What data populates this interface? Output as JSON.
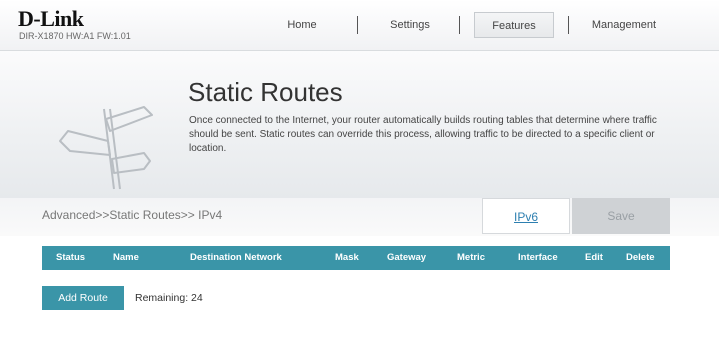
{
  "brand": {
    "logo": "D-Link",
    "model": "DIR-X1870 HW:A1 FW:1.01"
  },
  "nav": {
    "items": [
      {
        "label": "Home"
      },
      {
        "label": "Settings"
      },
      {
        "label": "Features",
        "active": true
      },
      {
        "label": "Management"
      }
    ]
  },
  "page": {
    "title": "Static Routes",
    "description": "Once connected to the Internet, your router automatically builds routing tables that determine where traffic should be sent. Static routes can override this process, allowing traffic to be directed to a specific client or location.",
    "breadcrumb": "Advanced>>Static Routes>> IPv4"
  },
  "tabs": {
    "ipv6_label": "IPv6",
    "save_label": "Save"
  },
  "table": {
    "columns": [
      "Status",
      "Name",
      "Destination Network",
      "Mask",
      "Gateway",
      "Metric",
      "Interface",
      "Edit",
      "Delete"
    ],
    "rows": []
  },
  "actions": {
    "add_route_label": "Add Route",
    "remaining_text": "Remaining: 24"
  },
  "colors": {
    "accent": "#3a95a8",
    "link": "#2d7fb0",
    "save_disabled": "#cfd2d5"
  },
  "icons": {
    "hero": "signpost-icon"
  }
}
